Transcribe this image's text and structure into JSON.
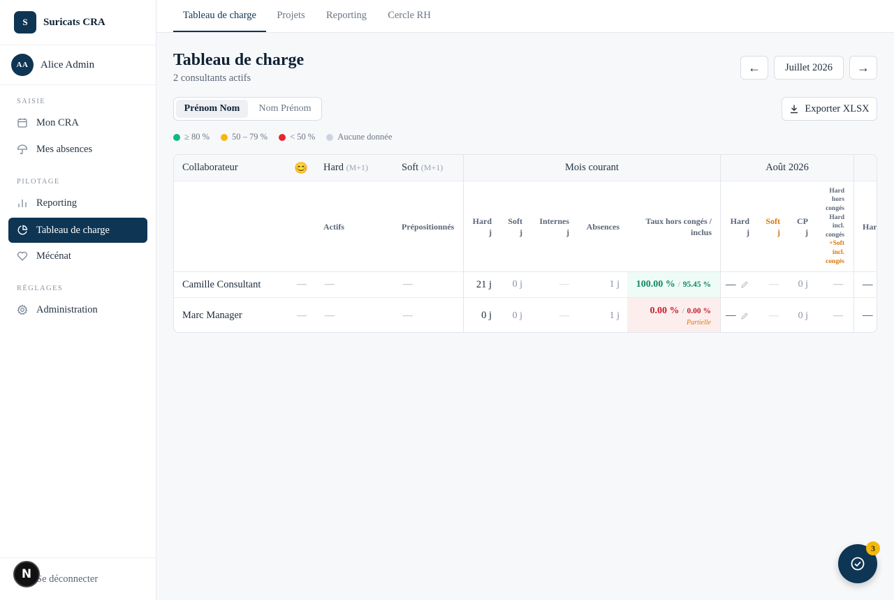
{
  "app": {
    "logo_letter": "S",
    "name": "Suricats CRA"
  },
  "user": {
    "initials": "AA",
    "name": "Alice Admin"
  },
  "sidebar": {
    "sections": [
      {
        "title": "SAISIE",
        "items": [
          {
            "label": "Mon CRA",
            "icon": "calendar-icon"
          },
          {
            "label": "Mes absences",
            "icon": "umbrella-icon"
          }
        ]
      },
      {
        "title": "PILOTAGE",
        "items": [
          {
            "label": "Reporting",
            "icon": "bar-chart-icon"
          },
          {
            "label": "Tableau de charge",
            "icon": "pie-chart-icon",
            "active": true
          },
          {
            "label": "Mécénat",
            "icon": "heart-icon"
          }
        ]
      },
      {
        "title": "RÉGLAGES",
        "items": [
          {
            "label": "Administration",
            "icon": "gear-icon"
          }
        ]
      }
    ],
    "logout": "Se déconnecter",
    "n_badge": "N"
  },
  "tabs": [
    {
      "label": "Tableau de charge",
      "active": true
    },
    {
      "label": "Projets"
    },
    {
      "label": "Reporting"
    },
    {
      "label": "Cercle RH"
    }
  ],
  "page": {
    "title": "Tableau de charge",
    "subtitle": "2 consultants actifs",
    "prev": "←",
    "month": "Juillet 2026",
    "next": "→",
    "export": "Exporter XLSX",
    "toggle": {
      "first": "Prénom Nom",
      "second": "Nom Prénom"
    },
    "legend": [
      {
        "label": "≥ 80 %",
        "color": "#10b981"
      },
      {
        "label": "50 – 79 %",
        "color": "#f5b70a"
      },
      {
        "label": "< 50 %",
        "color": "#e5262f"
      },
      {
        "label": "Aucune donnée",
        "color": "#cbd5e1"
      }
    ]
  },
  "table": {
    "header": {
      "collaborateur": "Collaborateur",
      "emoji": "😊",
      "hard": "Hard",
      "hard_sub": "(M+1)",
      "soft": "Soft",
      "soft_sub": "(M+1)",
      "mois": "Mois courant",
      "next_month": "Août 2026"
    },
    "subheader": {
      "actifs": "Actifs",
      "prepos": "Prépositionnés",
      "hard_j": [
        "Hard",
        "j"
      ],
      "soft_j": [
        "Soft",
        "j"
      ],
      "internes_j": [
        "Internes",
        "j"
      ],
      "absences": "Absences",
      "taux": [
        "Taux hors congés /",
        "inclus"
      ],
      "a_hard": [
        "Hard",
        "j"
      ],
      "a_soft": [
        "Soft",
        "j"
      ],
      "a_cp": [
        "CP",
        "j"
      ],
      "a_stack": [
        "Hard",
        "hors",
        "congés",
        "Hard",
        "incl.",
        "congés",
        "+Soft",
        "incl.",
        "congés"
      ],
      "cut": "Har"
    },
    "rows": [
      {
        "name": "Camille Consultant",
        "emoji": "—",
        "actifs": "—",
        "prepos": "—",
        "hard": "21 j",
        "soft": "0 j",
        "internes": "—",
        "absences": "1 j",
        "taux_main": "100.00 %",
        "taux_sep": "/",
        "taux_incl": "95.45 %",
        "taux_note": "",
        "a_hard": "—",
        "a_soft": "—",
        "a_cp": "0 j",
        "a_ratio": "—",
        "cut": "—"
      },
      {
        "name": "Marc Manager",
        "emoji": "—",
        "actifs": "—",
        "prepos": "—",
        "hard": "0 j",
        "soft": "0 j",
        "internes": "—",
        "absences": "1 j",
        "taux_main": "0.00 %",
        "taux_sep": "/",
        "taux_incl": "0.00 %",
        "taux_note": "Partielle",
        "a_hard": "—",
        "a_soft": "—",
        "a_cp": "0 j",
        "a_ratio": "—",
        "cut": "—"
      }
    ]
  },
  "fab": {
    "count": "3",
    "icon": "check-circle-icon"
  },
  "colors": {
    "primary": "#0e3553",
    "good_bg": "#eefbf6",
    "good_text": "#0f8a5f",
    "bad_bg": "#fdeeee",
    "bad_text": "#c81e28",
    "warn": "#d9760a"
  }
}
